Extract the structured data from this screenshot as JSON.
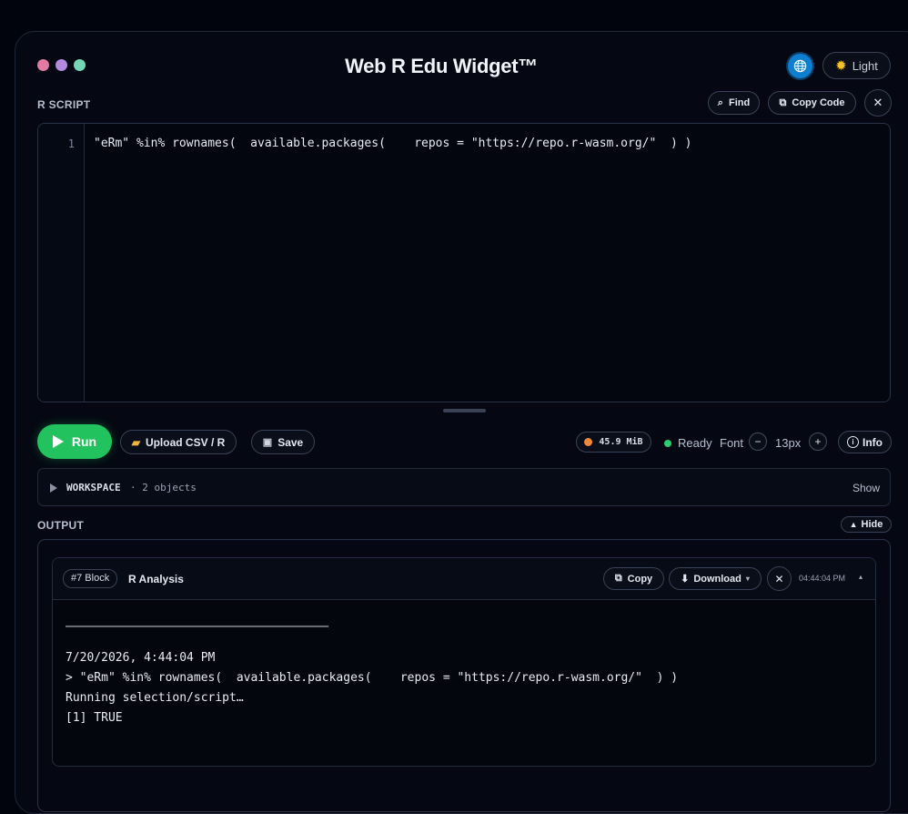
{
  "window": {
    "title": "Web R Edu Widget™",
    "dot_colors": [
      "#e27ba3",
      "#b38ae0",
      "#75d6b5"
    ],
    "theme_toggle_label": "Light"
  },
  "script": {
    "section_label": "R SCRIPT",
    "find_label": "Find",
    "copy_code_label": "Copy Code",
    "line_numbers": [
      "1"
    ],
    "code_lines": [
      "\"eRm\" %in% rownames(  available.packages(    repos = \"https://repo.r-wasm.org/\"  ) )"
    ]
  },
  "toolbar": {
    "run_label": "Run",
    "upload_label": "Upload CSV / R",
    "save_label": "Save",
    "memory": "45.9 MiB",
    "status": "Ready",
    "font_label": "Font",
    "font_size": "13px",
    "info_label": "Info",
    "accent_color": "#22c35e"
  },
  "workspace": {
    "label": "WORKSPACE",
    "summary": "· 2 objects",
    "toggle_label": "Show"
  },
  "output": {
    "section_label": "OUTPUT",
    "hide_label": "Hide",
    "block": {
      "badge": "#7 Block",
      "title": "R Analysis",
      "copy_label": "Copy",
      "download_label": "Download",
      "timestamp": "04:44:04 PM",
      "separator": "────────────────────────────────────────",
      "lines": [
        "7/20/2026, 4:44:04 PM",
        "> \"eRm\" %in% rownames(  available.packages(    repos = \"https://repo.r-wasm.org/\"  ) )",
        "Running selection/script…",
        "[1] TRUE"
      ]
    }
  }
}
